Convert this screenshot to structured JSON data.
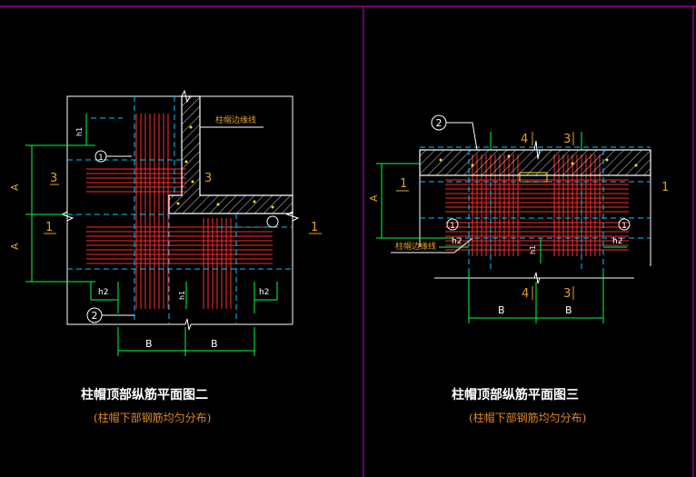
{
  "colors": {
    "background": "#000000",
    "frame": "#b400b4",
    "outline": "#ffffff",
    "rebar_h": "#ff2a2a",
    "rebar_v": "#ff3030",
    "dash": "#00c8ff",
    "dim": "#00ff40",
    "label": "#e0a020",
    "hatch": "#ffe020"
  },
  "left_drawing": {
    "title": "柱帽顶部纵筋平面图二",
    "subtitle": "(柱帽下部钢筋均匀分布)",
    "edge_note": "柱帽边缘线",
    "dim_a_top": "A",
    "dim_a_bottom": "A",
    "dim_b_left": "B",
    "dim_b_right": "B",
    "callout_1": "1",
    "callout_2": "2",
    "label_3_left": "3",
    "label_3_right": "3",
    "label_1_left": "1",
    "label_1_right": "1",
    "h1_top": "h1",
    "h1_bottom": "h1",
    "h2_left": "h2",
    "h2_right": "h2"
  },
  "right_drawing": {
    "title": "柱帽顶部纵筋平面图三",
    "subtitle": "(柱帽下部钢筋均匀分布)",
    "edge_note": "柱帽边缘线",
    "callout_2": "2",
    "callout_1_left": "1",
    "callout_1_right": "1",
    "dim_a": "A",
    "dim_b_left": "B",
    "dim_b_right": "B",
    "label_1_left": "1",
    "label_1_right": "1",
    "label_4_top": "4",
    "label_3_top": "3",
    "label_4_bottom": "4",
    "label_3_bottom": "3",
    "h1": "h1",
    "h2_left": "h2",
    "h2_right": "h2"
  }
}
